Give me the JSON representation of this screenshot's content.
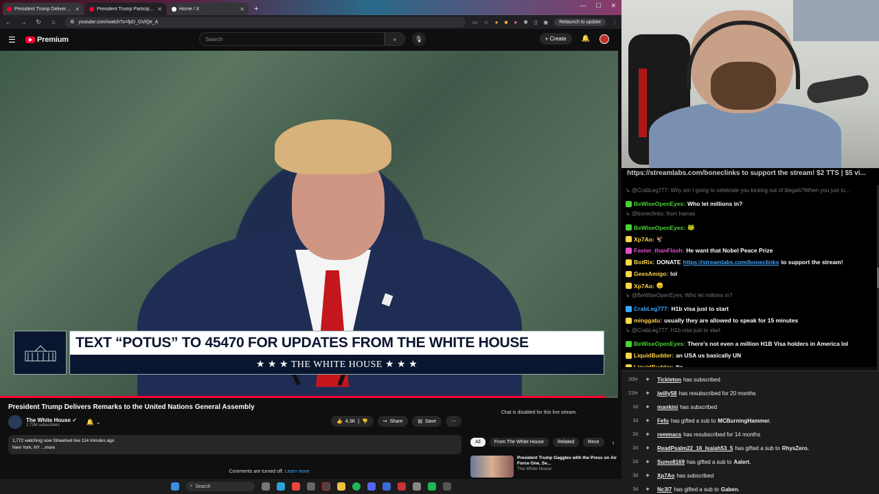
{
  "browser": {
    "tabs": [
      {
        "label": "President Trump Delivers Re",
        "active": false,
        "icon": "youtube-icon"
      },
      {
        "label": "President Trump Participates in",
        "active": true,
        "icon": "youtube-icon"
      },
      {
        "label": "Home / X",
        "active": false,
        "icon": "x-icon"
      }
    ],
    "url": "youtube.com/watch?v=fpD_GViQe_A",
    "relaunch_label": "Relaunch to update"
  },
  "youtube": {
    "logo_text": "Premium",
    "search_placeholder": "Search",
    "create_label": "Create"
  },
  "video": {
    "lower_third_text": "TEXT “POTUS” TO 45470 FOR UPDATES FROM THE WHITE HOUSE",
    "lower_third_brand": "★ ★ ★  THE WHITE HOUSE  ★ ★ ★",
    "progress_fraction": 0.98
  },
  "info": {
    "title": "President Trump Delivers Remarks to the United Nations General Assembly",
    "channel_name": "The White House",
    "subscribers": "2.73M subscribers",
    "likes": "4.3K",
    "share_label": "Share",
    "save_label": "Save",
    "desc_line1": "1,772 watching now  Streamed live 114 minutes ago",
    "desc_line2": "New York, NY ...more",
    "comments_off": "Comments are turned off.",
    "learn_more": "Learn more"
  },
  "sidebar": {
    "chat_disabled": "Chat is disabled for this live stream.",
    "chips": [
      "All",
      "From The White House",
      "Related",
      "Rece"
    ],
    "rec_title": "President Trump Gaggles with the Press on Air Force One, Se...",
    "rec_channel": "The White House"
  },
  "taskbar": {
    "search_label": "Search"
  },
  "chat": {
    "banner_link": "https://streamlabs.com/boneclinks",
    "banner_text": " to support the stream! $2 TTS | $5 vi...",
    "lines": [
      {
        "kind": "reply",
        "text": "@CrabLeg777: Why am I going to celebrate you kicking out of illegals?When you just tu..."
      },
      {
        "kind": "msg",
        "user": "BeWiseOpenEyes:",
        "color": "#4cd137",
        "text": " Who let millions in?"
      },
      {
        "kind": "reply",
        "text": "@boneclinks: from hamas"
      },
      {
        "kind": "msg",
        "user": "BeWiseOpenEyes:",
        "color": "#4cd137",
        "text": " 🐸"
      },
      {
        "kind": "msg",
        "user": "Xp7Ao:",
        "color": "#ffd54a",
        "text": " 🦅"
      },
      {
        "kind": "msg",
        "user": "Faster_thanFlash:",
        "color": "#e052d0",
        "text": " He want that Nobel Peace Prize"
      },
      {
        "kind": "msg",
        "user": "BotRix:",
        "color": "#ffd54a",
        "text": " DONATE ",
        "link": "https://streamlabs.com/boneclinks",
        "tail": " to support the stream!"
      },
      {
        "kind": "msg",
        "user": "GeesAmigo:",
        "color": "#ffd54a",
        "text": " lol"
      },
      {
        "kind": "msg",
        "user": "Xp7Ao:",
        "color": "#ffd54a",
        "text": " 😠"
      },
      {
        "kind": "reply",
        "text": "@BeWiseOpenEyes: Who let millions in?"
      },
      {
        "kind": "msg",
        "user": "CrabLeg777:",
        "color": "#3ea6ff",
        "text": " H1b visa just to start"
      },
      {
        "kind": "msg",
        "user": "minggatu:",
        "color": "#ffd54a",
        "text": " usually they are allowed to speak for 15 minutes"
      },
      {
        "kind": "reply",
        "text": "@CrabLeg777: H1b visa just to start"
      },
      {
        "kind": "msg",
        "user": "BeWiseOpenEyes:",
        "color": "#4cd137",
        "text": " There's not even a million H1B Visa holders in America lol"
      },
      {
        "kind": "msg",
        "user": "LiquidBudder:",
        "color": "#ffd54a",
        "text": " an USA us basically UN"
      },
      {
        "kind": "msg",
        "user": "LiquidBudder:",
        "color": "#ffd54a",
        "text": " *is"
      }
    ]
  },
  "events": [
    {
      "time": "20hr",
      "user": "Tickleton",
      "text": " has subscribed",
      "target": ""
    },
    {
      "time": "21hr",
      "user": "jwilly58",
      "text": " has resubscribed for 20 months",
      "target": ""
    },
    {
      "time": "1d",
      "user": "mankini",
      "text": " has subscribed",
      "target": ""
    },
    {
      "time": "1d",
      "user": "Fefu",
      "text": " has gifted a sub to",
      "target": "MCBurningHammer."
    },
    {
      "time": "2d",
      "user": "remmacs",
      "text": " has resubscribed for 14 months",
      "target": ""
    },
    {
      "time": "2d",
      "user": "ReadPsalm22_16_Isaiah53_5",
      "text": " has gifted a sub to",
      "target": "RhysZero."
    },
    {
      "time": "2d",
      "user": "Sumo8169",
      "text": " has gifted a sub to",
      "target": "Aalert."
    },
    {
      "time": "3d",
      "user": "Xp7Ao",
      "text": " has subscribed",
      "target": ""
    },
    {
      "time": "3d",
      "user": "Nc3l7",
      "text": " has gifted a sub to",
      "target": "Gaben."
    }
  ]
}
